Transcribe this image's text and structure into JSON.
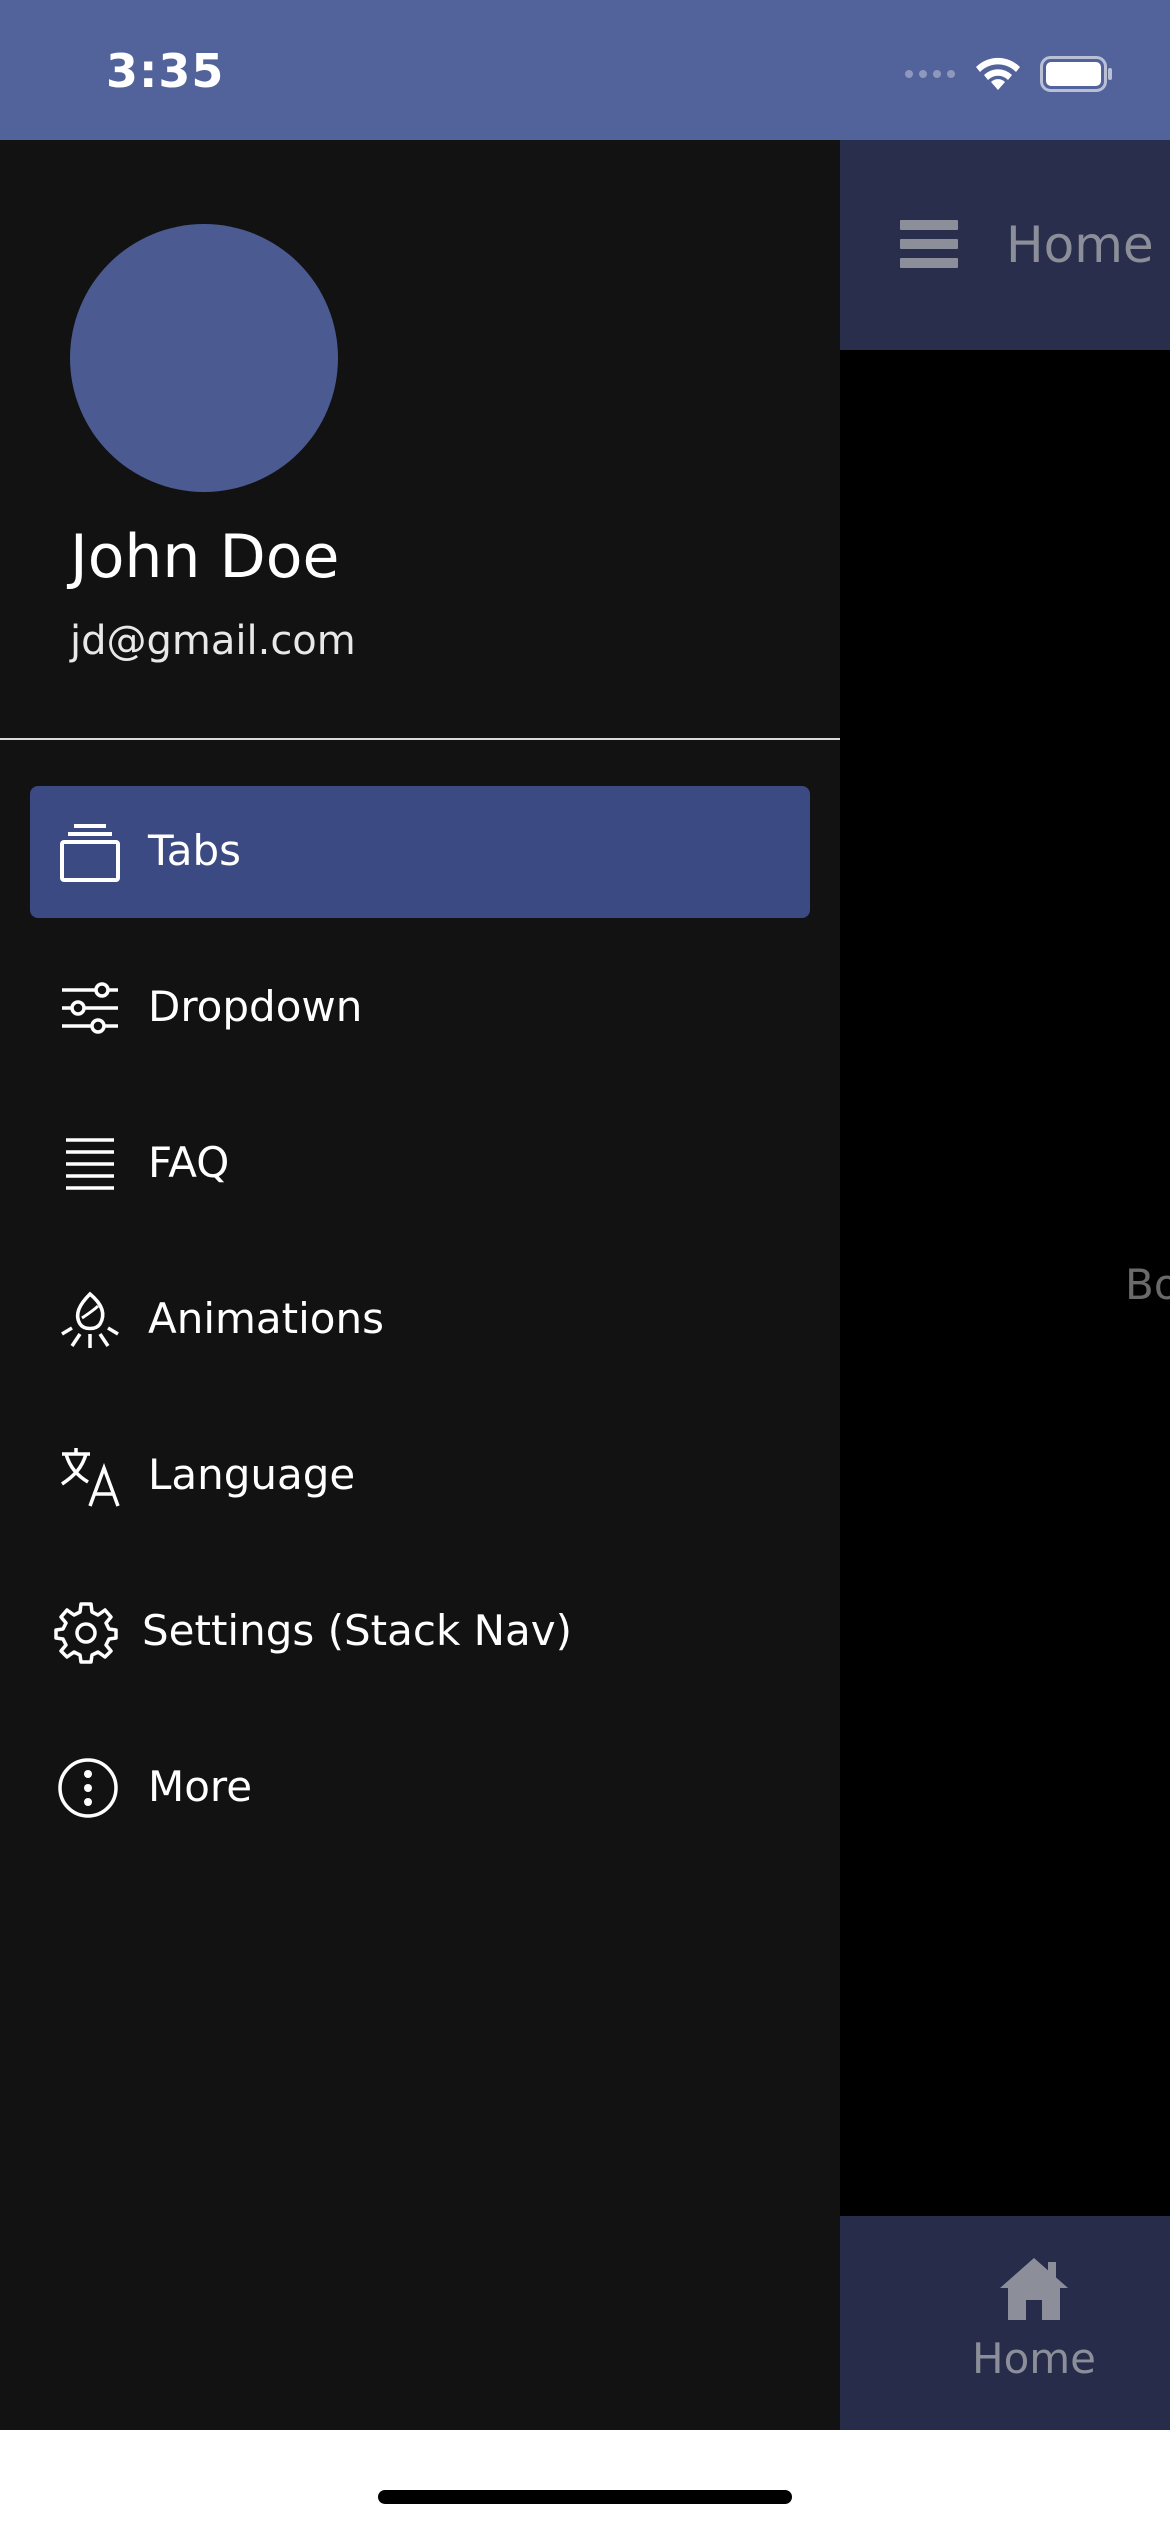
{
  "status_bar": {
    "time": "3:35",
    "background": "#52629a",
    "icons": [
      "signal-icon",
      "wifi-icon",
      "battery-icon"
    ]
  },
  "background_screen": {
    "header_title": "Home",
    "header_icon": "hamburger-menu-icon",
    "body_text_partial": "Bo",
    "tab_bar": {
      "items": [
        {
          "label": "Home",
          "icon": "home-icon"
        }
      ]
    }
  },
  "drawer": {
    "user": {
      "name": "John Doe",
      "email": "jd@gmail.com",
      "avatar_color": "#4b5a91"
    },
    "items": [
      {
        "label": "Tabs",
        "icon": "tabs-icon",
        "active": true
      },
      {
        "label": "Dropdown",
        "icon": "sliders-icon",
        "active": false
      },
      {
        "label": "FAQ",
        "icon": "list-lines-icon",
        "active": false
      },
      {
        "label": "Animations",
        "icon": "campfire-icon",
        "active": false
      },
      {
        "label": "Language",
        "icon": "translate-icon",
        "active": false
      },
      {
        "label": "Settings (Stack Nav)",
        "icon": "gear-icon",
        "active": false
      },
      {
        "label": "More",
        "icon": "more-vertical-icon",
        "active": false
      }
    ],
    "active_color": "#3b4a82",
    "background": "#121212"
  }
}
